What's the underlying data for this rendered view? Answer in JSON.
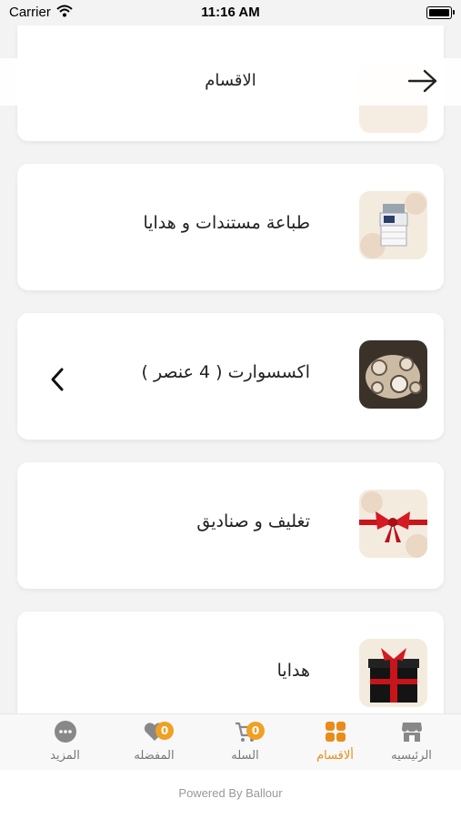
{
  "status_bar": {
    "carrier": "Carrier",
    "time": "11:16 AM"
  },
  "header": {
    "title": "الاقسام"
  },
  "categories": [
    {
      "title": "طباعة مستندات و هدايا"
    },
    {
      "title": "اكسسوارت ( 4 عنصر )"
    },
    {
      "title": "تغليف و صناديق"
    },
    {
      "title": "هدايا"
    }
  ],
  "tabbar": {
    "home": "الرئيسيه",
    "categories": "ألاقسام",
    "cart": "السله",
    "cart_badge": "0",
    "favorites": "المفضله",
    "favorites_badge": "0",
    "more": "المزيد"
  },
  "footer": {
    "powered": "Powered By Ballour"
  },
  "colors": {
    "accent": "#e88d1c",
    "badge": "#f0a024"
  }
}
